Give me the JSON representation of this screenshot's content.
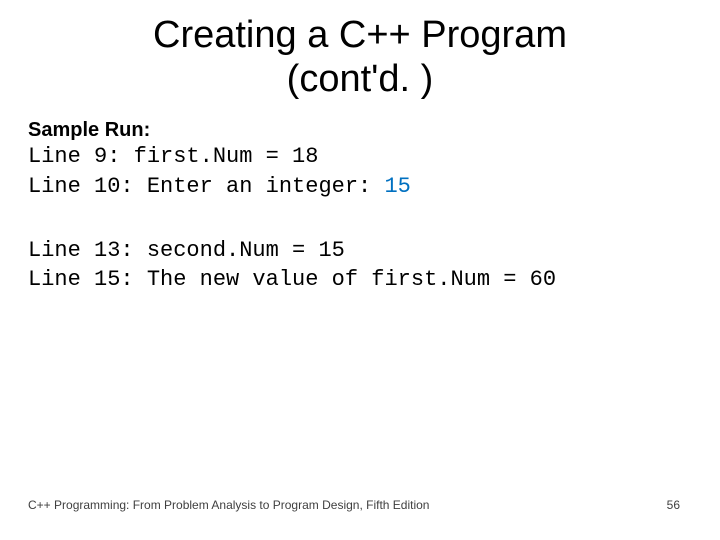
{
  "title_line1": "Creating a C++ Program",
  "title_line2": "(cont'd. )",
  "sample_label": "Sample Run:",
  "block1": {
    "line1": "Line 9: first.Num = 18",
    "line2_prefix": "Line 10: Enter an integer: ",
    "line2_input": "15"
  },
  "block2": {
    "line1": "Line 13: second.Num = 15",
    "line2": "Line 15: The new value of first.Num = 60"
  },
  "footer_left": "C++ Programming: From Problem Analysis to Program Design, Fifth Edition",
  "footer_right": "56"
}
